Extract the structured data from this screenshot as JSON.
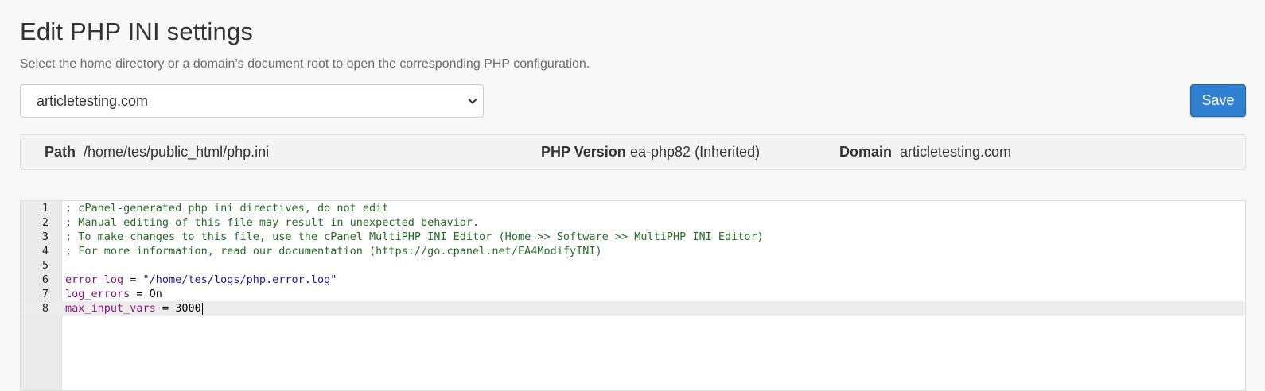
{
  "page": {
    "title": "Edit PHP INI settings",
    "subtitle": "Select the home directory or a domain’s document root to open the corresponding PHP configuration."
  },
  "domain_select": {
    "selected": "articletesting.com",
    "icon": "chevron-down-icon"
  },
  "toolbar": {
    "save_label": "Save",
    "accent": "#2f80d1"
  },
  "info": {
    "path_label": "Path",
    "path_value": "/home/tes/public_html/php.ini",
    "version_label": "PHP Version",
    "version_value": "ea-php82 (Inherited)",
    "domain_label": "Domain",
    "domain_value": "articletesting.com"
  },
  "editor": {
    "active_line": 8,
    "lines": [
      {
        "n": "1",
        "text": "; cPanel-generated php ini directives, do not edit"
      },
      {
        "n": "2",
        "text": "; Manual editing of this file may result in unexpected behavior."
      },
      {
        "n": "3",
        "text": "; To make changes to this file, use the cPanel MultiPHP INI Editor (Home >> Software >> MultiPHP INI Editor)"
      },
      {
        "n": "4",
        "text": "; For more information, read our documentation (https://go.cpanel.net/EA4ModifyINI)"
      },
      {
        "n": "5",
        "text": ""
      },
      {
        "n": "6",
        "key": "error_log",
        "op": " = ",
        "value": "\"/home/tes/logs/php.error.log\""
      },
      {
        "n": "7",
        "key": "log_errors",
        "op": " = ",
        "value": "On"
      },
      {
        "n": "8",
        "key": "max_input_vars",
        "op": " = ",
        "value": "3000"
      }
    ]
  }
}
